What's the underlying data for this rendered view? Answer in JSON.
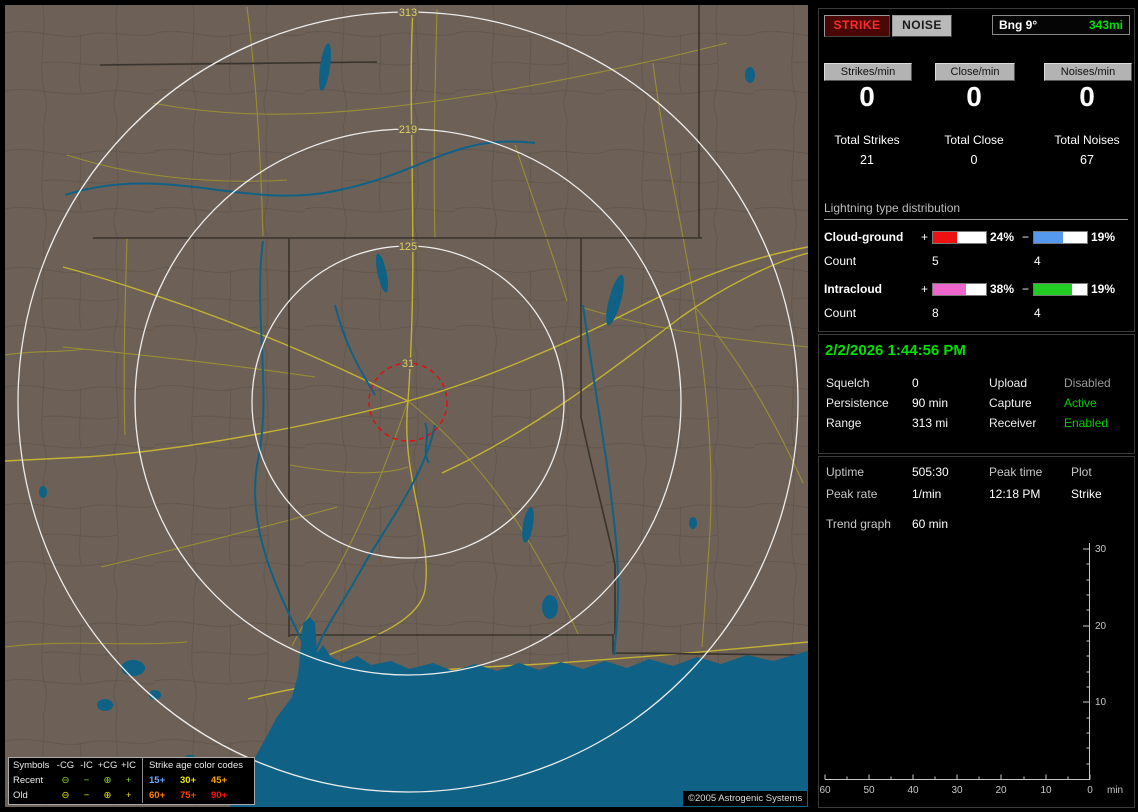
{
  "map": {
    "ring_labels": [
      "313",
      "219",
      "125",
      "31"
    ],
    "copyright": "©2005 Astrogenic Systems",
    "colors": {
      "land": "#6d6057",
      "water": "#0f6285",
      "ring": "#ededed",
      "close_ring": "#dd1111",
      "road_major": "#c3b232",
      "road_minor": "#9d9430",
      "ring_label": "#ddd05e"
    },
    "legend": {
      "symbols_header": "Symbols",
      "symbol_cols": [
        "-CG",
        "-IC",
        "+CG",
        "+IC"
      ],
      "age_header": "Strike age color codes",
      "recent_label": "Recent",
      "old_label": "Old",
      "symbol_glyphs": [
        "⊖",
        "−",
        "⊕",
        "+"
      ],
      "recent_symbol_color": "#8fd43a",
      "old_symbol_color": "#e0e020",
      "recent_ages": [
        {
          "label": "15+",
          "color": "#66aaff"
        },
        {
          "label": "30+",
          "color": "#e8e800"
        },
        {
          "label": "45+",
          "color": "#ffa000"
        }
      ],
      "old_ages": [
        {
          "label": "60+",
          "color": "#ff8000"
        },
        {
          "label": "75+",
          "color": "#ff4400"
        },
        {
          "label": "90+",
          "color": "#ff1111"
        }
      ]
    }
  },
  "panel": {
    "strike_button": "STRIKE",
    "noise_button": "NOISE",
    "bearing": {
      "label": "Bng 9°",
      "range": "343mi",
      "range_color": "#00dd00"
    },
    "rates": [
      {
        "label": "Strikes/min",
        "value": "0"
      },
      {
        "label": "Close/min",
        "value": "0"
      },
      {
        "label": "Noises/min",
        "value": "0"
      }
    ],
    "totals": [
      {
        "label": "Total Strikes",
        "value": "21"
      },
      {
        "label": "Total Close",
        "value": "0"
      },
      {
        "label": "Total Noises",
        "value": "67"
      }
    ],
    "distribution": {
      "title": "Lightning type distribution",
      "rows": [
        {
          "label": "Cloud-ground",
          "plus_sign": "+",
          "plus_pct": "24%",
          "plus_color": "#ee1111",
          "plus_fill": "45%",
          "minus_sign": "−",
          "minus_pct": "19%",
          "minus_color": "#5599ee",
          "minus_fill": "55%",
          "count_label": "Count",
          "plus_count": "5",
          "minus_count": "4"
        },
        {
          "label": "Intracloud",
          "plus_sign": "+",
          "plus_pct": "38%",
          "plus_color": "#ee66cc",
          "plus_fill": "62%",
          "minus_sign": "−",
          "minus_pct": "19%",
          "minus_color": "#22cc22",
          "minus_fill": "72%",
          "count_label": "Count",
          "plus_count": "8",
          "minus_count": "4"
        }
      ]
    },
    "datetime": "2/2/2026 1:44:56 PM",
    "datetime_color": "#00e000",
    "settings": [
      {
        "label": "Squelch",
        "value": "0",
        "label2": "Upload",
        "value2": "Disabled",
        "value2_color": "#999999"
      },
      {
        "label": "Persistence",
        "value": "90 min",
        "label2": "Capture",
        "value2": "Active",
        "value2_color": "#00cc00"
      },
      {
        "label": "Range",
        "value": "313 mi",
        "label2": "Receiver",
        "value2": "Enabled",
        "value2_color": "#00cc00"
      }
    ],
    "status": {
      "uptime_label": "Uptime",
      "uptime_value": "505:30",
      "peak_time_label": "Peak time",
      "plot_label": "Plot",
      "peak_rate_label": "Peak rate",
      "peak_rate_value": "1/min",
      "peak_time_value": "12:18 PM",
      "plot_value": "Strike",
      "trend_label": "Trend graph",
      "trend_value": "60 min"
    },
    "trend_chart": {
      "type": "line",
      "title": "Trend graph 60 min",
      "y_ticks": [
        "30",
        "20",
        "10"
      ],
      "x_ticks": [
        "60",
        "50",
        "40",
        "30",
        "20",
        "10",
        "0"
      ],
      "x_unit": "min",
      "y_range": [
        0,
        30
      ],
      "x_range_min": [
        60,
        0
      ],
      "series": []
    }
  }
}
